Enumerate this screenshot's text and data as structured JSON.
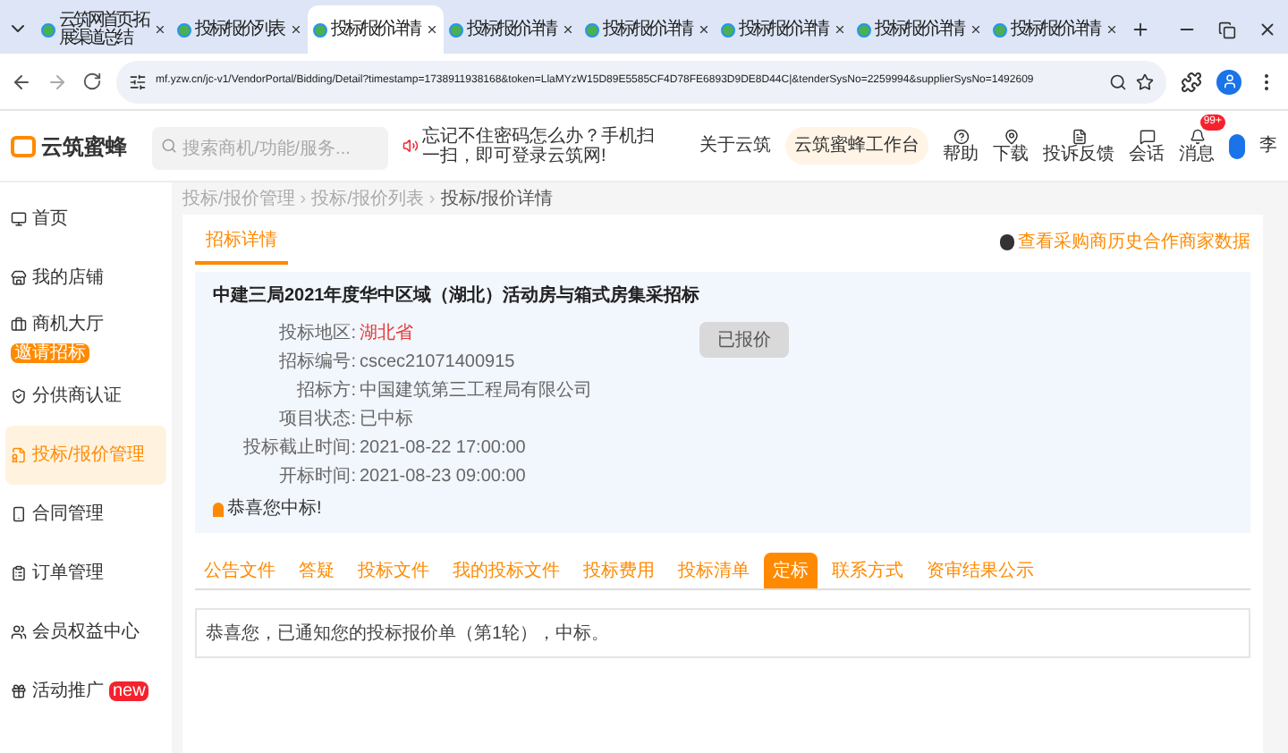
{
  "browser": {
    "tabs": [
      {
        "title": "云筑网首页-拓展渠道总结",
        "selected": false
      },
      {
        "title": "投标/报价列表",
        "selected": false
      },
      {
        "title": "投标/报价详情",
        "selected": true
      },
      {
        "title": "投标/报价详情",
        "selected": false
      },
      {
        "title": "投标/报价详情",
        "selected": false
      },
      {
        "title": "投标/报价详情",
        "selected": false
      },
      {
        "title": "投标/报价详情",
        "selected": false
      },
      {
        "title": "投标/报价详情",
        "selected": false
      }
    ],
    "url": "mf.yzw.cn/jc-v1/VendorPortal/Bidding/Detail?timestamp=1738911938168&token=LlaMYzW15D89E5585CF4D78FE6893D9DE8D44C|&tenderSysNo=2259994&supplierSysNo=1492609"
  },
  "header": {
    "logo": "云筑蜜蜂",
    "search_placeholder": "搜索商机/功能/服务...",
    "notice": "忘记不住密码怎么办？手机扫一扫，即可登录云筑网!",
    "link": "关于云筑",
    "workbench": "云筑蜜蜂工作台",
    "tools": [
      {
        "label": "帮助"
      },
      {
        "label": "下载"
      },
      {
        "label": "投诉反馈"
      },
      {
        "label": "会话"
      },
      {
        "label": "消息",
        "badge": "99+"
      }
    ],
    "user": "李"
  },
  "sidebar": {
    "items": [
      {
        "label": "首页",
        "selected": false
      },
      {
        "label": "我的店铺",
        "selected": false
      },
      {
        "label": "商机大厅",
        "selected": false,
        "badge": {
          "text": "邀请招标",
          "color": "#ff8a00"
        }
      },
      {
        "label": "分供商认证",
        "selected": false
      },
      {
        "label": "投标/报价管理",
        "selected": true
      },
      {
        "label": "合同管理",
        "selected": false
      },
      {
        "label": "订单管理",
        "selected": false
      },
      {
        "label": "会员权益中心",
        "selected": false
      },
      {
        "label": "活动推广",
        "selected": false,
        "badge": {
          "text": "new",
          "color": "#f5222d"
        }
      }
    ]
  },
  "breadcrumb": {
    "separator": "›",
    "items": [
      "投标/报价管理",
      "投标/报价列表",
      "投标/报价详情"
    ]
  },
  "page_tabs": [
    {
      "label": "招标详情",
      "selected": true
    }
  ],
  "history_link": "查看采购商历史合作商家数据",
  "tender": {
    "title": "中建三局2021年度华中区域（湖北）活动房与箱式房集采招标",
    "status_button": "已报价",
    "fields": [
      {
        "label": "投标地区:",
        "value": "湖北省",
        "highlight": true
      },
      {
        "label": "招标编号:",
        "value": "cscec21071400915",
        "highlight": false
      },
      {
        "label": "招标方:",
        "value": "中国建筑第三工程局有限公司",
        "highlight": false
      },
      {
        "label": "项目状态:",
        "value": "已中标",
        "highlight": false
      },
      {
        "label": "投标截止时间:",
        "value": "2021-08-22 17:00:00",
        "highlight": false
      },
      {
        "label": "开标时间:",
        "value": "2021-08-23 09:00:00",
        "highlight": false
      }
    ],
    "notice": "恭喜您中标!"
  },
  "detail_tabs": [
    {
      "label": "公告文件",
      "selected": false
    },
    {
      "label": "答疑",
      "selected": false
    },
    {
      "label": "投标文件",
      "selected": false
    },
    {
      "label": "我的投标文件",
      "selected": false
    },
    {
      "label": "投标费用",
      "selected": false
    },
    {
      "label": "投标清单",
      "selected": false
    },
    {
      "label": "定标",
      "selected": true
    },
    {
      "label": "联系方式",
      "selected": false
    },
    {
      "label": "资审结果公示",
      "selected": false
    }
  ],
  "result_text": "恭喜您，已通知您的投标报价单（第1轮），中标。"
}
